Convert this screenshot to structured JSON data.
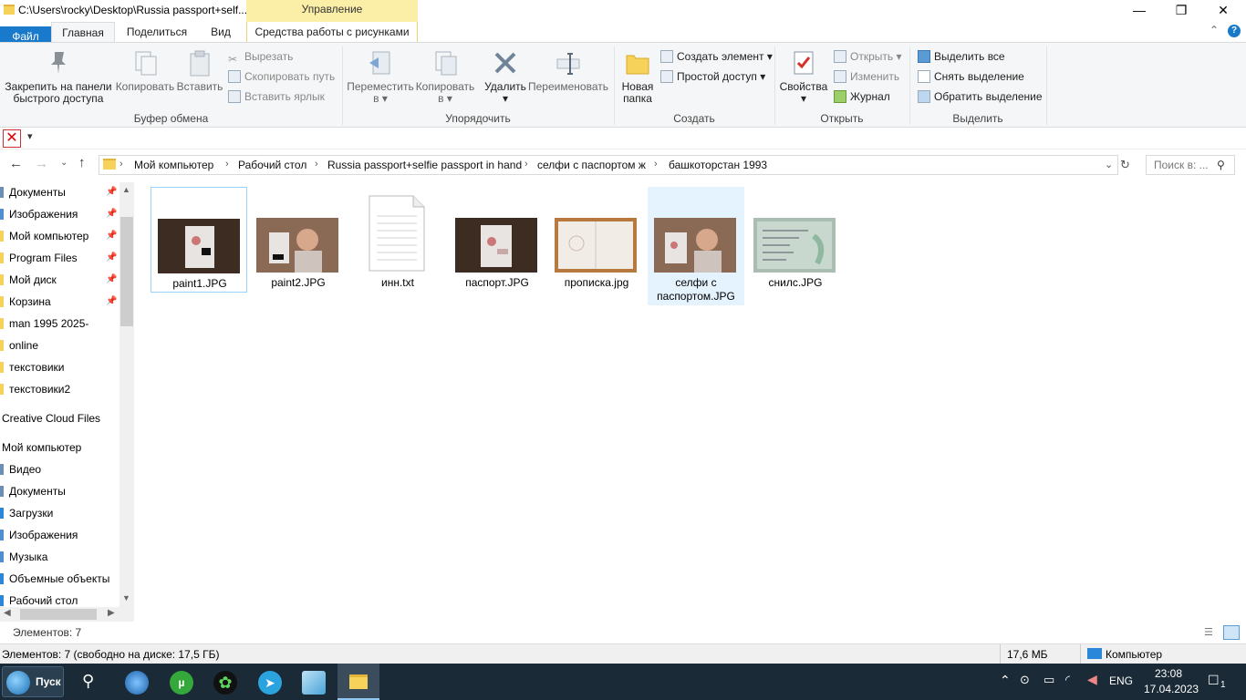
{
  "window": {
    "title": "C:\\Users\\rocky\\Desktop\\Russia passport+self...",
    "context_tab": "Управление",
    "minimize": "—",
    "maximize": "❐",
    "close": "✕"
  },
  "tabs": {
    "file": "Файл",
    "home": "Главная",
    "share": "Поделиться",
    "view": "Вид",
    "picture_tools": "Средства работы с рисунками"
  },
  "ribbon": {
    "clipboard": {
      "pin_label_1": "Закрепить на панели",
      "pin_label_2": "быстрого доступа",
      "copy": "Копировать",
      "paste": "Вставить",
      "cut": "Вырезать",
      "copy_path": "Скопировать путь",
      "paste_shortcut": "Вставить ярлык",
      "group": "Буфер обмена"
    },
    "organize": {
      "move_1": "Переместить",
      "move_2": "в",
      "copyto_1": "Копировать",
      "copyto_2": "в",
      "delete": "Удалить",
      "rename": "Переименовать",
      "group": "Упорядочить"
    },
    "new": {
      "new_folder_1": "Новая",
      "new_folder_2": "папка",
      "new_item": "Создать элемент",
      "easy_access": "Простой доступ",
      "group": "Создать"
    },
    "open": {
      "properties": "Свойства",
      "open": "Открыть",
      "edit": "Изменить",
      "history": "Журнал",
      "group": "Открыть"
    },
    "select": {
      "select_all": "Выделить все",
      "select_none": "Снять выделение",
      "invert": "Обратить выделение",
      "group": "Выделить"
    }
  },
  "address": {
    "crumbs": [
      "Мой компьютер",
      "Рабочий стол",
      "Russia passport+selfie passport in hand",
      "селфи с паспортом ж",
      "башкоторстан 1993"
    ],
    "search_placeholder": "Поиск в: ..."
  },
  "nav": {
    "items": [
      {
        "label": "Документы",
        "pinned": true
      },
      {
        "label": "Изображения",
        "pinned": true
      },
      {
        "label": "Мой компьютер",
        "pinned": true
      },
      {
        "label": "Program Files",
        "pinned": true
      },
      {
        "label": "Мой диск",
        "pinned": true
      },
      {
        "label": "Корзина",
        "pinned": true
      },
      {
        "label": "man 1995 2025-",
        "pinned": false
      },
      {
        "label": "online",
        "pinned": false
      },
      {
        "label": "текстовики",
        "pinned": false
      },
      {
        "label": "текстовики2",
        "pinned": false
      }
    ],
    "creative_cloud": "Creative Cloud Files",
    "this_pc": "Мой компьютер",
    "pc_items": [
      "Видео",
      "Документы",
      "Загрузки",
      "Изображения",
      "Музыка",
      "Объемные объекты",
      "Рабочий стол"
    ]
  },
  "files": [
    {
      "name": "paint1.JPG",
      "kind": "photo-passport"
    },
    {
      "name": "paint2.JPG",
      "kind": "photo-selfie"
    },
    {
      "name": "инн.txt",
      "kind": "text"
    },
    {
      "name": "паспорт.JPG",
      "kind": "photo-passport"
    },
    {
      "name": "прописка.jpg",
      "kind": "photo-page"
    },
    {
      "name_line1": "селфи  с",
      "name_line2": "паспортом.JPG",
      "kind": "photo-selfie"
    },
    {
      "name": "снилс.JPG",
      "kind": "photo-card"
    }
  ],
  "status": {
    "items_count": "Элементов: 7",
    "detail": "Элементов: 7 (свободно на диске: 17,5 ГБ)",
    "size": "17,6 МБ",
    "location": "Компьютер"
  },
  "taskbar": {
    "start": "Пуск",
    "lang": "ENG",
    "time": "23:08",
    "date": "17.04.2023",
    "notif": "1"
  },
  "colors": {
    "accent": "#1979ca",
    "context_tab": "#fbefa8",
    "selection": "#e5f3ff",
    "taskbar": "#1a2a36"
  }
}
